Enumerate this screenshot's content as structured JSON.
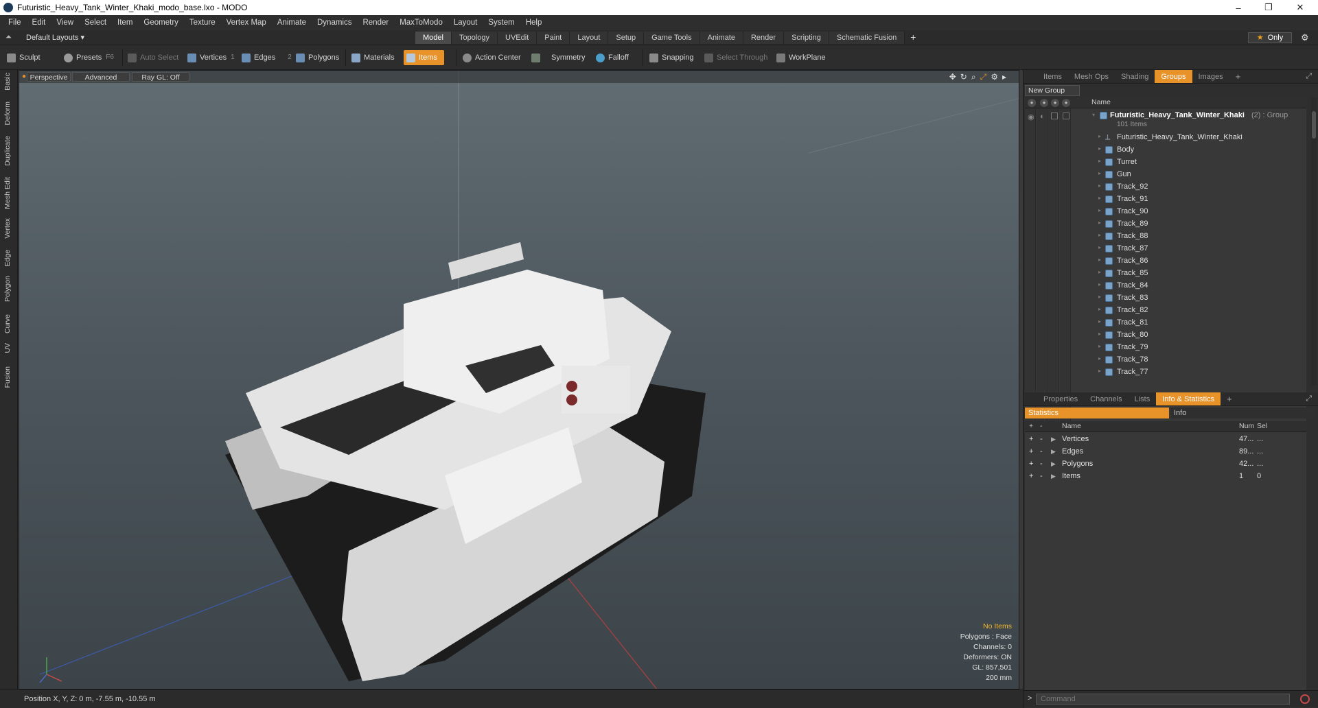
{
  "window": {
    "title": "Futuristic_Heavy_Tank_Winter_Khaki_modo_base.lxo - MODO",
    "controls": [
      "–",
      "❐",
      "✕"
    ]
  },
  "menu": [
    "File",
    "Edit",
    "View",
    "Select",
    "Item",
    "Geometry",
    "Texture",
    "Vertex Map",
    "Animate",
    "Dynamics",
    "Render",
    "MaxToModo",
    "Layout",
    "System",
    "Help"
  ],
  "layout_bar": {
    "layout_label": "Default Layouts ▾",
    "tabs": [
      "Model",
      "Topology",
      "UVEdit",
      "Paint",
      "Layout",
      "Setup",
      "Game Tools",
      "Animate",
      "Render",
      "Scripting",
      "Schematic Fusion"
    ],
    "active_tab": "Model",
    "plus": "+",
    "only_label": "Only"
  },
  "toolbar": {
    "sculpt": "Sculpt",
    "presets": "Presets",
    "presets_key": "F6",
    "auto_select": "Auto Select",
    "vertices": "Vertices",
    "vertices_count": "1",
    "edges": "Edges",
    "edges_count": "2",
    "polygons": "Polygons",
    "materials": "Materials",
    "items": "Items",
    "action_center": "Action Center",
    "symmetry": "Symmetry",
    "falloff": "Falloff",
    "snapping": "Snapping",
    "select_through": "Select Through",
    "workplane": "WorkPlane"
  },
  "left_tabs": [
    "Basic",
    "Deform",
    "Duplicate",
    "Mesh Edit",
    "Vertex",
    "Edge",
    "Polygon",
    "Curve",
    "UV",
    "Fusion"
  ],
  "viewport": {
    "perspective": "Perspective",
    "advanced": "Advanced",
    "raygl": "Ray GL: Off",
    "info": {
      "no_items": "No Items",
      "polygons": "Polygons : Face",
      "channels": "Channels: 0",
      "deformers": "Deformers: ON",
      "gl": "GL: 857,501",
      "scale": "200 mm"
    }
  },
  "status": {
    "position": "Position X, Y, Z:  0 m, -7.55 m, -10.55 m"
  },
  "items_panel": {
    "tabs": [
      "Items",
      "Mesh Ops",
      "Shading",
      "Groups",
      "Images"
    ],
    "active_tab": "Groups",
    "plus": "+",
    "new_group": "New Group",
    "header_name": "Name",
    "group_name": "Futuristic_Heavy_Tank_Winter_Khaki",
    "group_suffix": "(2) : Group",
    "group_count": "101 Items",
    "items": [
      "Futuristic_Heavy_Tank_Winter_Khaki",
      "Body",
      "Turret",
      "Gun",
      "Track_92",
      "Track_91",
      "Track_90",
      "Track_89",
      "Track_88",
      "Track_87",
      "Track_86",
      "Track_85",
      "Track_84",
      "Track_83",
      "Track_82",
      "Track_81",
      "Track_80",
      "Track_79",
      "Track_78",
      "Track_77"
    ]
  },
  "stats_panel": {
    "tabs": [
      "Properties",
      "Channels",
      "Lists",
      "Info & Statistics"
    ],
    "active_tab": "Info & Statistics",
    "plus": "+",
    "sub_statistics": "Statistics",
    "sub_info": "Info",
    "headers": {
      "name": "Name",
      "num": "Num",
      "sel": "Sel"
    },
    "rows": [
      {
        "name": "Vertices",
        "num": "47...",
        "sel": "..."
      },
      {
        "name": "Edges",
        "num": "89...",
        "sel": "..."
      },
      {
        "name": "Polygons",
        "num": "42...",
        "sel": "..."
      },
      {
        "name": "Items",
        "num": "1",
        "sel": "0"
      }
    ]
  },
  "command": {
    "placeholder": "Command",
    "prompt": ">"
  },
  "colors": {
    "accent": "#e8932a",
    "warn_text": "#f2b52d",
    "mesh_icon": "#7aa3c9"
  }
}
